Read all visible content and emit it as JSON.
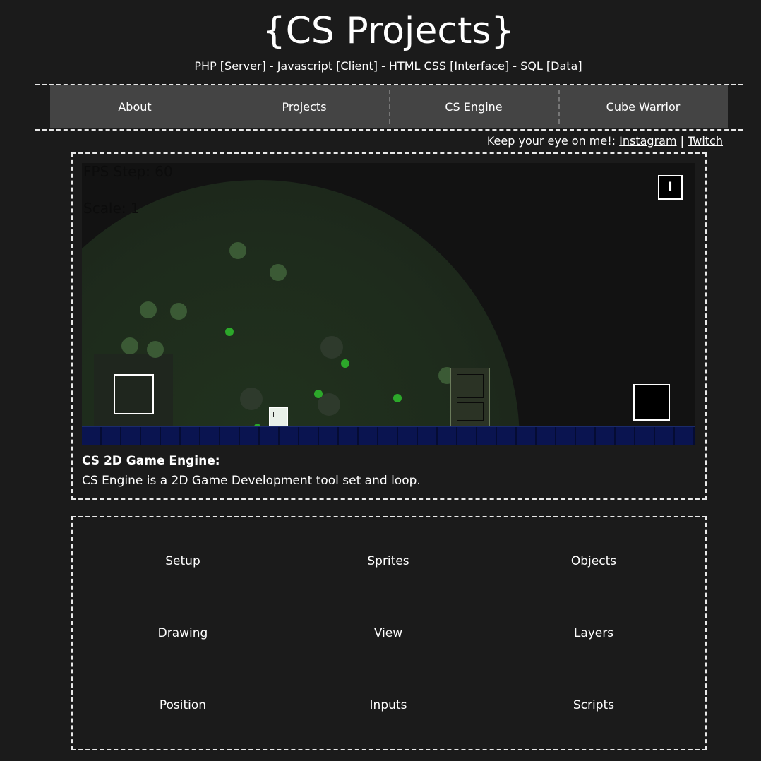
{
  "header": {
    "title": "{CS Projects}",
    "subtitle": "PHP [Server] - Javascript [Client] - HTML CSS [Interface] - SQL [Data]"
  },
  "nav": {
    "items": [
      {
        "label": "About"
      },
      {
        "label": "Projects"
      },
      {
        "label": "CS Engine"
      },
      {
        "label": "Cube Warrior"
      }
    ]
  },
  "social": {
    "prefix": "Keep your eye on me!:",
    "links": [
      {
        "label": "Instagram"
      },
      {
        "label": "Twitch"
      }
    ],
    "separator": "|"
  },
  "game": {
    "fps_text": "FPS Step: 60",
    "scale_text": "Scale: 1",
    "info_label": "i",
    "colors": {
      "background": "#121212",
      "ground": "#0a1450",
      "orb": "#2ca82a",
      "door": "#2b3325"
    }
  },
  "description": {
    "title": "CS 2D Game Engine:",
    "text": "CS Engine is a 2D Game Development tool set and loop."
  },
  "topics": [
    {
      "label": "Setup"
    },
    {
      "label": "Sprites"
    },
    {
      "label": "Objects"
    },
    {
      "label": "Drawing"
    },
    {
      "label": "View"
    },
    {
      "label": "Layers"
    },
    {
      "label": "Position"
    },
    {
      "label": "Inputs"
    },
    {
      "label": "Scripts"
    }
  ]
}
